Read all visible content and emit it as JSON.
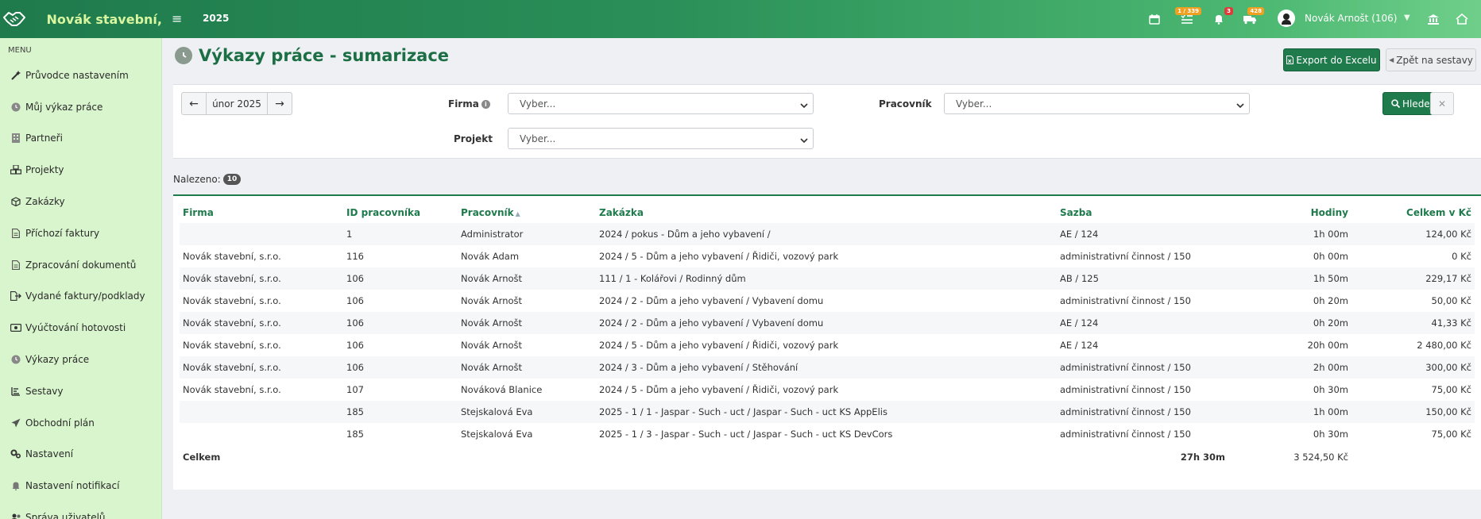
{
  "app": {
    "brand": "Novák stavební,",
    "year": "2025",
    "badges": {
      "tasks": "1 / 339",
      "notifications": "3",
      "trucks": "428"
    },
    "user": "Novák Arnošt (106)"
  },
  "sidebar": {
    "menu_title": "MENU",
    "items": [
      {
        "label": "Průvodce nastavením",
        "icon": "wand-icon"
      },
      {
        "label": "Můj výkaz práce",
        "icon": "clock-icon"
      },
      {
        "label": "Partneři",
        "icon": "building-icon"
      },
      {
        "label": "Projekty",
        "icon": "cubes-icon"
      },
      {
        "label": "Zakázky",
        "icon": "cube-icon"
      },
      {
        "label": "Příchozí faktury",
        "icon": "document-icon"
      },
      {
        "label": "Zpracování dokumentů",
        "icon": "document-icon"
      },
      {
        "label": "Vydané faktury/podklady",
        "icon": "export-icon"
      },
      {
        "label": "Vyúčtování hotovosti",
        "icon": "money-icon"
      },
      {
        "label": "Výkazy práce",
        "icon": "clock-icon"
      },
      {
        "label": "Sestavy",
        "icon": "list-icon"
      },
      {
        "label": "Obchodní plán",
        "icon": "paper-plane-icon"
      },
      {
        "label": "Nastavení",
        "icon": "gears-icon"
      },
      {
        "label": "Nastavení notifikací",
        "icon": "bell-icon"
      },
      {
        "label": "Správa uživatelů",
        "icon": "users-icon"
      }
    ]
  },
  "page": {
    "title": "Výkazy práce - sumarizace",
    "export_label": "Export do Excelu",
    "back_label": "Zpět na sestavy"
  },
  "filters": {
    "month": "únor 2025",
    "firma_label": "Firma",
    "pracovnik_label": "Pracovník",
    "projekt_label": "Projekt",
    "firma_value": "Vyber...",
    "pracovnik_value": "Vyber...",
    "projekt_value": "Vyber...",
    "search_label": "Hledej"
  },
  "results": {
    "found_label": "Nalezeno:",
    "count": "10"
  },
  "table": {
    "headers": {
      "firma": "Firma",
      "id": "ID pracovníka",
      "pracovnik": "Pracovník",
      "zakazka": "Zakázka",
      "sazba": "Sazba",
      "hodiny": "Hodiny",
      "celkem": "Celkem v Kč"
    },
    "rows": [
      {
        "firma": "",
        "id": "1",
        "pracovnik": "Administrator",
        "zakazka": "2024 / pokus - Dům a jeho vybavení /",
        "sazba": "AE  / 124",
        "hodiny": "1h 00m",
        "celkem": "124,00 Kč"
      },
      {
        "firma": "Novák stavební, s.r.o.",
        "id": "116",
        "pracovnik": "Novák Adam",
        "zakazka": "2024 / 5 - Dům a jeho vybavení / Řidiči, vozový park",
        "sazba": "administrativní činnost  / 150",
        "hodiny": "0h 00m",
        "celkem": "0 Kč"
      },
      {
        "firma": "Novák stavební, s.r.o.",
        "id": "106",
        "pracovnik": "Novák Arnošt",
        "zakazka": "111 / 1 - Kolářovi / Rodinný dům",
        "sazba": "AB  / 125",
        "hodiny": "1h 50m",
        "celkem": "229,17 Kč"
      },
      {
        "firma": "Novák stavební, s.r.o.",
        "id": "106",
        "pracovnik": "Novák Arnošt",
        "zakazka": "2024 / 2 - Dům a jeho vybavení / Vybavení domu",
        "sazba": "administrativní činnost  / 150",
        "hodiny": "0h 20m",
        "celkem": "50,00 Kč"
      },
      {
        "firma": "Novák stavební, s.r.o.",
        "id": "106",
        "pracovnik": "Novák Arnošt",
        "zakazka": "2024 / 2 - Dům a jeho vybavení / Vybavení domu",
        "sazba": "AE  / 124",
        "hodiny": "0h 20m",
        "celkem": "41,33 Kč"
      },
      {
        "firma": "Novák stavební, s.r.o.",
        "id": "106",
        "pracovnik": "Novák Arnošt",
        "zakazka": "2024 / 5 - Dům a jeho vybavení / Řidiči, vozový park",
        "sazba": "AE  / 124",
        "hodiny": "20h 00m",
        "celkem": "2 480,00 Kč"
      },
      {
        "firma": "Novák stavební, s.r.o.",
        "id": "106",
        "pracovnik": "Novák Arnošt",
        "zakazka": "2024 / 3 - Dům a jeho vybavení / Stěhování",
        "sazba": "administrativní činnost  / 150",
        "hodiny": "2h 00m",
        "celkem": "300,00 Kč"
      },
      {
        "firma": "Novák stavební, s.r.o.",
        "id": "107",
        "pracovnik": "Nováková Blanice",
        "zakazka": "2024 / 5 - Dům a jeho vybavení / Řidiči, vozový park",
        "sazba": "administrativní činnost  / 150",
        "hodiny": "0h 30m",
        "celkem": "75,00 Kč"
      },
      {
        "firma": "",
        "id": "185",
        "pracovnik": "Stejskalová Eva",
        "zakazka": "2025 - 1 / 1 - Jaspar - Such - uct / Jaspar - Such - uct KS AppElis",
        "sazba": "administrativní činnost  / 150",
        "hodiny": "1h 00m",
        "celkem": "150,00 Kč"
      },
      {
        "firma": "",
        "id": "185",
        "pracovnik": "Stejskalová Eva",
        "zakazka": "2025 - 1 / 3 - Jaspar - Such - uct / Jaspar - Such - uct KS DevCors",
        "sazba": "administrativní činnost  / 150",
        "hodiny": "0h 30m",
        "celkem": "75,00 Kč"
      }
    ],
    "footer": {
      "label": "Celkem",
      "hodiny": "27h 30m",
      "celkem": "3 524,50 Kč"
    }
  }
}
